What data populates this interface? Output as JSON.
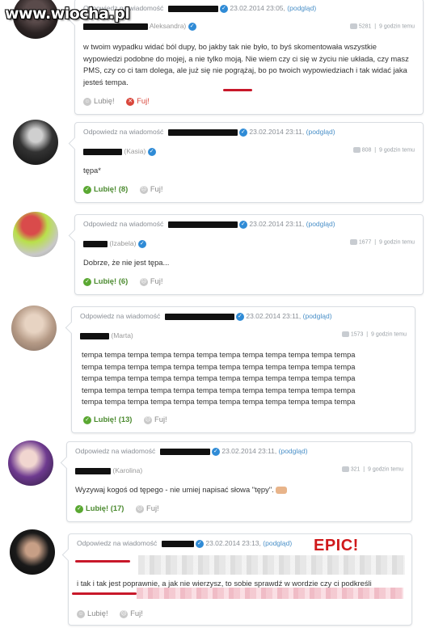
{
  "watermark": "www.wiocha.pl",
  "epic_label": "EPIC!",
  "common": {
    "reply_to": "Odpowiedz na wiadomość",
    "preview": "(podgląd)",
    "like": "Lubię!",
    "dislike": "Fuj!",
    "time_ago": "9 godzin temu"
  },
  "posts": [
    {
      "date": "23.02.2014 23:05,",
      "author": "",
      "author_partial": "Aleksandra)",
      "views": "5281",
      "text": "w twoim wypadku widać ból dupy, bo jakby tak nie było, to byś skomentowała wszystkie wypowiedzi podobne do mojej, a nie tylko moją. Nie wiem czy ci się w życiu nie układa, czy masz PMS, czy co ci tam dolega, ale już się nie pogrążaj, bo po twoich wypowiedziach i tak widać jaka jesteś tempa.",
      "likes": ""
    },
    {
      "date": "23.02.2014 23:11,",
      "author": "(Kasia)",
      "views": "808",
      "text": "tępa*",
      "likes": "(8)"
    },
    {
      "date": "23.02.2014 23:11,",
      "author": "(Izabela)",
      "views": "1677",
      "text": "Dobrze, że nie jest tępa...",
      "likes": "(6)"
    },
    {
      "date": "23.02.2014 23:11,",
      "author": "(Marta)",
      "views": "1573",
      "text_rows": [
        "tempa tempa tempa tempa tempa tempa tempa tempa tempa tempa tempa tempa",
        "tempa tempa tempa tempa tempa tempa tempa tempa tempa tempa tempa tempa",
        "tempa tempa tempa tempa tempa tempa tempa tempa tempa tempa tempa tempa",
        "tempa tempa tempa tempa tempa tempa tempa tempa tempa tempa tempa tempa",
        "tempa tempa tempa tempa tempa tempa tempa tempa tempa tempa tempa tempa"
      ],
      "likes": "(13)"
    },
    {
      "date": "23.02.2014 23:11,",
      "author": "(Karolina)",
      "views": "321",
      "text": "Wyzywaj kogoś od tępego - nie umiej napisać słowa \"tępy\".",
      "likes": "(17)"
    },
    {
      "date": "23.02.2014 23:13,",
      "author": "",
      "views": "",
      "text": "i tak i tak jest poprawnie, a jak nie wierzysz, to sobie sprawdź w wordzie czy ci podkreśli",
      "likes": ""
    }
  ],
  "colors": {
    "accent_blue": "#2f8bd6",
    "like_green": "#5aa832",
    "fuj_red": "#d9473c",
    "epic_red": "#d0191b"
  }
}
